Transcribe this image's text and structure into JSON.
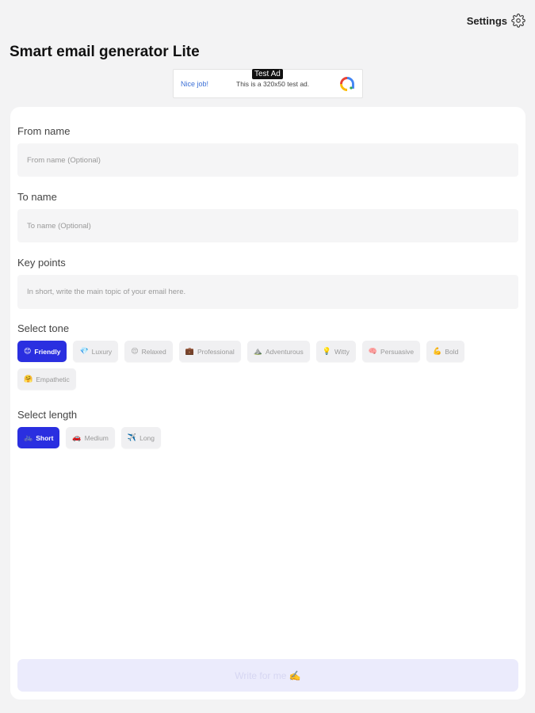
{
  "header": {
    "settings_label": "Settings",
    "title": "Smart email generator Lite"
  },
  "ad": {
    "label": "Test Ad",
    "headline": "Nice job!",
    "description": "This is a 320x50 test ad."
  },
  "form": {
    "from": {
      "label": "From name",
      "placeholder": "From name (Optional)"
    },
    "to": {
      "label": "To name",
      "placeholder": "To name (Optional)"
    },
    "key_points": {
      "label": "Key points",
      "placeholder": "In short, write the main topic of your email here."
    },
    "tone": {
      "label": "Select tone",
      "options": [
        {
          "emoji": "😊",
          "label": "Friendly",
          "selected": true
        },
        {
          "emoji": "💎",
          "label": "Luxury",
          "selected": false
        },
        {
          "emoji": "😌",
          "label": "Relaxed",
          "selected": false
        },
        {
          "emoji": "💼",
          "label": "Professional",
          "selected": false
        },
        {
          "emoji": "⛰️",
          "label": "Adventurous",
          "selected": false
        },
        {
          "emoji": "💡",
          "label": "Witty",
          "selected": false
        },
        {
          "emoji": "🧠",
          "label": "Persuasive",
          "selected": false
        },
        {
          "emoji": "💪",
          "label": "Bold",
          "selected": false
        },
        {
          "emoji": "🤗",
          "label": "Empathetic",
          "selected": false
        }
      ]
    },
    "length": {
      "label": "Select length",
      "options": [
        {
          "emoji": "🚲",
          "label": "Short",
          "selected": true
        },
        {
          "emoji": "🚗",
          "label": "Medium",
          "selected": false
        },
        {
          "emoji": "✈️",
          "label": "Long",
          "selected": false
        }
      ]
    },
    "submit_label": "Write for me ✍️"
  },
  "colors": {
    "accent": "#2a2fe0",
    "background": "#f3f3f4",
    "card": "#ffffff",
    "chip_inactive": "#f0f0f2",
    "button_disabled": "#ebebfc"
  }
}
